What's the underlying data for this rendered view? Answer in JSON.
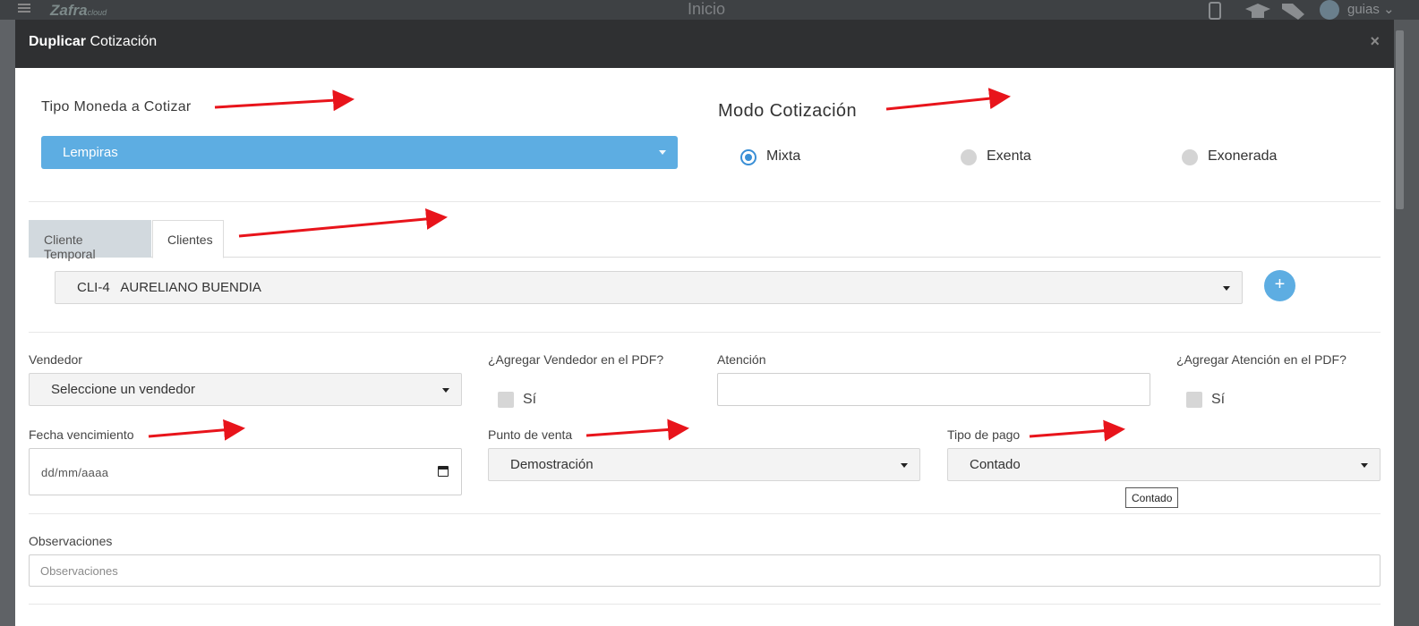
{
  "app": {
    "logo": "Zafra",
    "logo_suffix": "cloud",
    "page_title": "Inicio",
    "user_name": "guias"
  },
  "modal": {
    "title_bold": "Duplicar",
    "title_rest": " Cotización",
    "close_glyph": "×"
  },
  "currency": {
    "label": "Tipo Moneda a Cotizar",
    "selected": "Lempiras"
  },
  "mode": {
    "label": "Modo Cotización",
    "options": [
      {
        "label": "Mixta",
        "checked": true
      },
      {
        "label": "Exenta",
        "checked": false
      },
      {
        "label": "Exonerada",
        "checked": false
      }
    ]
  },
  "client_tabs": {
    "tabs": [
      {
        "label": "Cliente Temporal",
        "active": false
      },
      {
        "label": "Clientes",
        "active": true
      }
    ],
    "selected_client": "CLI-4   AURELIANO BUENDIA",
    "add_glyph": "+"
  },
  "vendor": {
    "label": "Vendedor",
    "selected": "Seleccione un vendedor"
  },
  "vendor_pdf": {
    "label": "¿Agregar Vendedor en el PDF?",
    "checkbox_label": "Sí"
  },
  "attention": {
    "label": "Atención",
    "value": ""
  },
  "attention_pdf": {
    "label": "¿Agregar Atención en el PDF?",
    "checkbox_label": "Sí"
  },
  "due_date": {
    "label": "Fecha vencimiento",
    "placeholder": "dd/mm/aaaa"
  },
  "point_of_sale": {
    "label": "Punto de venta",
    "selected": "Demostración"
  },
  "payment_type": {
    "label": "Tipo de pago",
    "selected": "Contado",
    "tooltip": "Contado"
  },
  "observations": {
    "label": "Observaciones",
    "placeholder": "Observaciones"
  },
  "colors": {
    "accent": "#5dade2",
    "header_bg": "#2f3032",
    "arrow": "#e8141b"
  },
  "icons": [
    "menu-icon",
    "phone-icon",
    "graduation-cap-icon",
    "tags-icon",
    "user-avatar-icon",
    "chevron-down-icon",
    "close-icon",
    "caret-down-icon",
    "calendar-icon",
    "plus-icon",
    "annotation-arrow"
  ]
}
